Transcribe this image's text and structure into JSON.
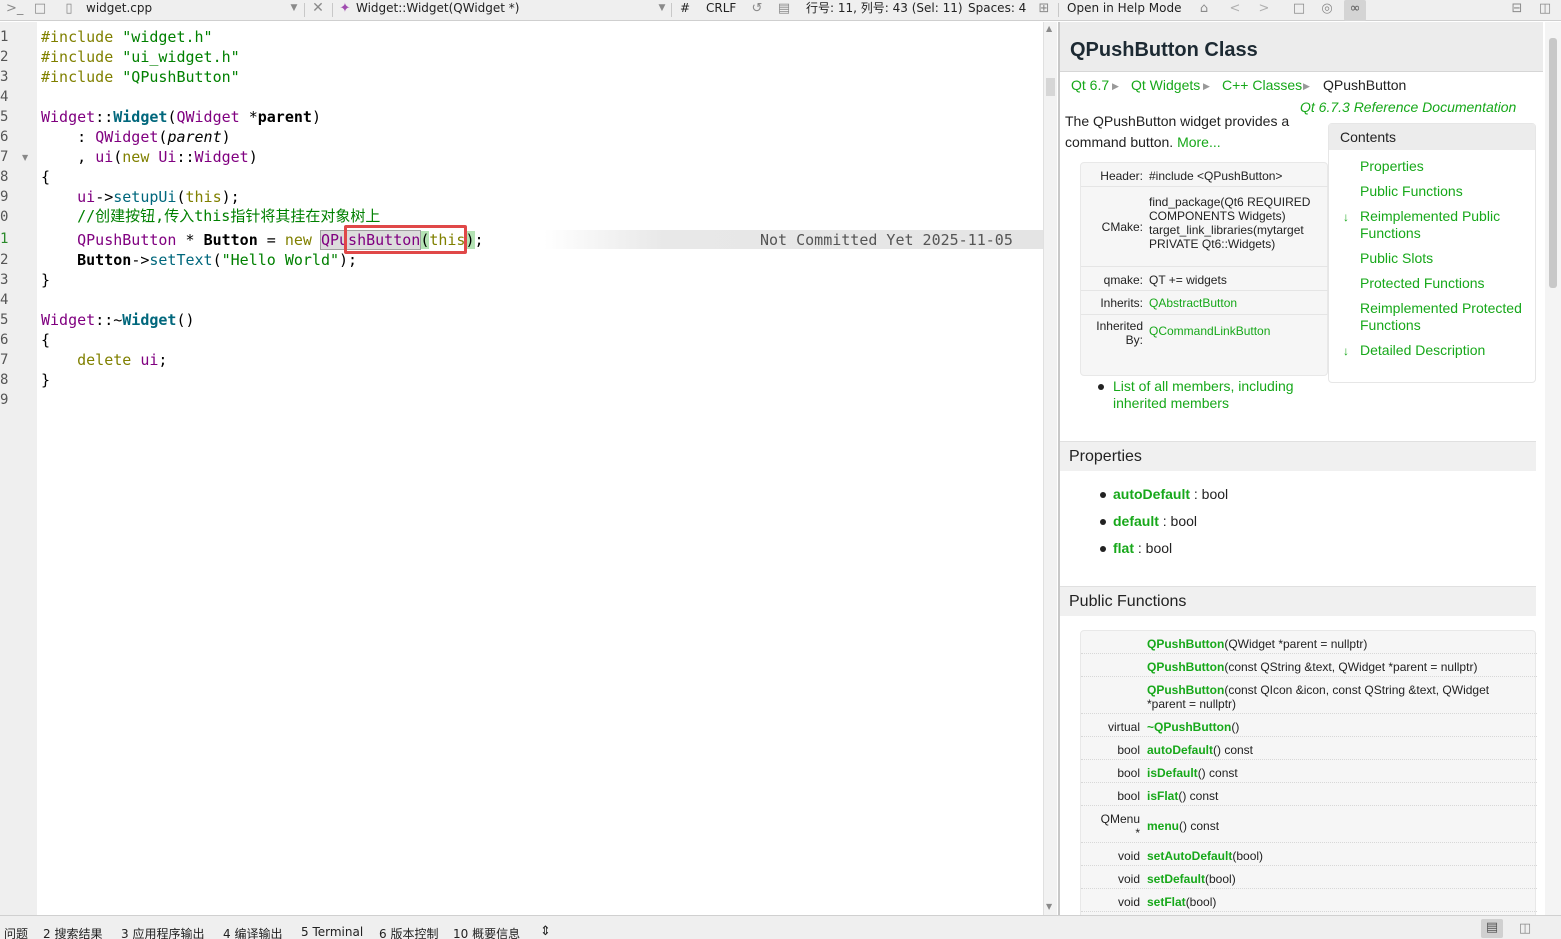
{
  "toolbar": {
    "file_name": "widget.cpp",
    "function_name": "Widget::Widget(QWidget *)",
    "hash": "#",
    "line_ending": "CRLF",
    "cursor_pos": "行号: 11, 列号: 43 (Sel: 11)",
    "indent": "Spaces: 4",
    "help_mode": "Open in Help Mode",
    "icons": [
      "terminal-icon",
      "lock-icon",
      "file-icon",
      "dropdown-icon",
      "close-icon",
      "function-icon",
      "dropdown-icon",
      "encoding-icon",
      "split-icon",
      "home-icon",
      "back-icon",
      "forward-icon",
      "bookmark-icon",
      "globe-icon",
      "link-icon",
      "expand-icon",
      "split-pane-icon"
    ]
  },
  "editor": {
    "line_numbers": [
      "1",
      "2",
      "3",
      "4",
      "5",
      "6",
      "7",
      "8",
      "9",
      "0",
      "1",
      "2",
      "3",
      "4",
      "5",
      "6",
      "7",
      "8",
      "9"
    ],
    "current_line_index": 10,
    "lines": {
      "l1": {
        "kw": "#include ",
        "str": "\"widget.h\""
      },
      "l2": {
        "kw": "#include ",
        "str": "\"ui_widget.h\""
      },
      "l3": {
        "kw": "#include ",
        "str": "\"QPushButton\""
      },
      "l5": {
        "cls": "Widget",
        "sep": "::",
        "fn": "Widget",
        "p1": "(",
        "type": "QWidget",
        "star": " *",
        "param": "parent",
        "p2": ")"
      },
      "l6": {
        "lead": "    : ",
        "fn": "QWidget",
        "p1": "(",
        "param": "parent",
        "p2": ")"
      },
      "l7": {
        "lead": "    , ",
        "fn": "ui",
        "p1": "(",
        "kw": "new ",
        "cls": "Ui",
        "sep": "::",
        "type": "Widget",
        "p2": ")"
      },
      "l8": {
        "brace": "{"
      },
      "l9": {
        "lead": "    ",
        "obj": "ui",
        "arrow": "->",
        "fn": "setupUi",
        "p1": "(",
        "kw": "this",
        "p2": ");"
      },
      "l10": {
        "comment": "    //创建按钮,传入this指针将其挂在对象树上"
      },
      "l11": {
        "lead": "    ",
        "type": "QPushButton",
        "mid": " * ",
        "var": "Button",
        "eq": " = ",
        "kw": "new ",
        "ctor": "QPushButton",
        "p1": "(",
        "kw2": "this",
        "p2": ")",
        "end": ";"
      },
      "l12": {
        "lead": "    ",
        "var": "Button",
        "arrow": "->",
        "fn": "setText",
        "p1": "(",
        "str": "\"Hello World\"",
        "p2": ");"
      },
      "l13": {
        "brace": "}"
      },
      "l15": {
        "cls": "Widget",
        "sep": "::~",
        "fn": "Widget",
        "p": "()"
      },
      "l16": {
        "brace": "{"
      },
      "l17": {
        "lead": "    ",
        "kw": "delete ",
        "var": "ui",
        "end": ";"
      },
      "l18": {
        "brace": "}"
      }
    },
    "blame": "Not Committed Yet 2025-11-05"
  },
  "help": {
    "title": "QPushButton Class",
    "breadcrumb": [
      "Qt 6.7",
      "Qt Widgets",
      "C++ Classes",
      "QPushButton"
    ],
    "ref_doc": "Qt 6.7.3 Reference Documentation",
    "intro": "The QPushButton widget provides a command button.",
    "more": "More...",
    "meta": [
      {
        "label": "Header:",
        "value": "#include <QPushButton>"
      },
      {
        "label": "CMake:",
        "value": "find_package(Qt6 REQUIRED COMPONENTS Widgets) target_link_libraries(mytarget PRIVATE Qt6::Widgets)"
      },
      {
        "label": "qmake:",
        "value": "QT += widgets"
      },
      {
        "label": "Inherits:",
        "value": "QAbstractButton"
      },
      {
        "label": "Inherited By:",
        "value": "QCommandLinkButton"
      }
    ],
    "contents_title": "Contents",
    "contents": [
      "Properties",
      "Public Functions",
      "Reimplemented Public Functions",
      "Public Slots",
      "Protected Functions",
      "Reimplemented Protected Functions",
      "Detailed Description"
    ],
    "list_members": "List of all members, including inherited members",
    "properties_title": "Properties",
    "properties": [
      {
        "name": "autoDefault",
        "type": " : bool"
      },
      {
        "name": "default",
        "type": " : bool"
      },
      {
        "name": "flat",
        "type": " : bool"
      }
    ],
    "functions_title": "Public Functions",
    "functions": [
      {
        "ret": "",
        "name": "QPushButton",
        "args": "(QWidget *parent = nullptr)"
      },
      {
        "ret": "",
        "name": "QPushButton",
        "args": "(const QString &text, QWidget *parent = nullptr)"
      },
      {
        "ret": "",
        "name": "QPushButton",
        "args": "(const QIcon &icon, const QString &text, QWidget *parent = nullptr)"
      },
      {
        "ret": "virtual",
        "name": "~QPushButton",
        "args": "()"
      },
      {
        "ret": "bool",
        "name": "autoDefault",
        "args": "() const"
      },
      {
        "ret": "bool",
        "name": "isDefault",
        "args": "() const"
      },
      {
        "ret": "bool",
        "name": "isFlat",
        "args": "() const"
      },
      {
        "ret": "QMenu *",
        "name": "menu",
        "args": "() const"
      },
      {
        "ret": "void",
        "name": "setAutoDefault",
        "args": "(bool)"
      },
      {
        "ret": "void",
        "name": "setDefault",
        "args": "(bool)"
      },
      {
        "ret": "void",
        "name": "setFlat",
        "args": "(bool)"
      }
    ]
  },
  "statusbar": {
    "items": [
      "问题",
      "2  搜索结果",
      "3  应用程序输出",
      "4  编译输出",
      "5  Terminal",
      "6  版本控制",
      "10  概要信息"
    ]
  }
}
